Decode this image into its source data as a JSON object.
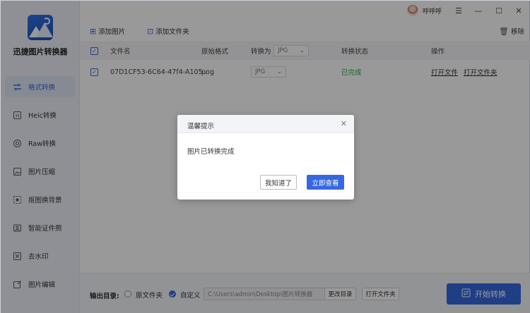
{
  "app": {
    "title": "迅捷图片转换器"
  },
  "user": {
    "name": "呼呼呼"
  },
  "window_controls": {
    "menu": "☰",
    "minimize": "—",
    "maximize": "☐",
    "close": "✕"
  },
  "sidebar": {
    "items": [
      {
        "label": "格式转换",
        "icon": "format-convert-icon",
        "active": true
      },
      {
        "label": "Heic转换",
        "icon": "heic-icon"
      },
      {
        "label": "Raw转换",
        "icon": "raw-icon"
      },
      {
        "label": "图片压缩",
        "icon": "compress-icon"
      },
      {
        "label": "抠图换背景",
        "icon": "cutout-icon"
      },
      {
        "label": "智能证件照",
        "icon": "id-photo-icon"
      },
      {
        "label": "去水印",
        "icon": "watermark-icon"
      },
      {
        "label": "图片编辑",
        "icon": "edit-icon"
      }
    ]
  },
  "toolbar": {
    "add_image": "添加图片",
    "add_folder": "添加文件夹",
    "remove": "移除"
  },
  "table": {
    "headers": {
      "filename": "文件名",
      "original_format": "原始格式",
      "convert_to": "转换为",
      "status": "转换状态",
      "action": "操作"
    },
    "header_select": "JPG",
    "rows": [
      {
        "filename": "07D1CF53-6C64-47f4-A105...",
        "format": "png",
        "target": "JPG",
        "status": "已完成",
        "open_file": "打开文件",
        "open_folder": "打开文件夹"
      }
    ]
  },
  "dialog": {
    "title": "温馨提示",
    "close": "✕",
    "message": "图片已转换完成",
    "ok": "我知道了",
    "view": "立即查看"
  },
  "bottom": {
    "output_label": "输出目录:",
    "original_folder": "原文件夹",
    "custom": "自定义",
    "path": "C:\\Users\\admin\\Desktop\\图片转换器",
    "change_dir": "更改目录",
    "open_folder": "打开文件夹",
    "start": "开始转换"
  },
  "colors": {
    "accent": "#3568e0",
    "success": "#29a745"
  }
}
